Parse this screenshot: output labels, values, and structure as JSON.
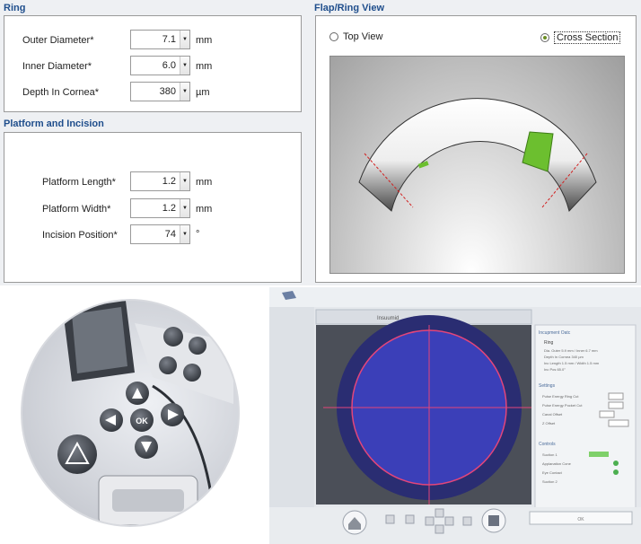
{
  "ring": {
    "title": "Ring",
    "fields": [
      {
        "label": "Outer Diameter*",
        "value": "7.1",
        "unit": "mm"
      },
      {
        "label": "Inner Diameter*",
        "value": "6.0",
        "unit": "mm"
      },
      {
        "label": "Depth In Cornea*",
        "value": "380",
        "unit": "µm"
      }
    ]
  },
  "platform": {
    "title": "Platform and Incision",
    "fields": [
      {
        "label": "Platform Length*",
        "value": "1.2",
        "unit": "mm"
      },
      {
        "label": "Platform Width*",
        "value": "1.2",
        "unit": "mm"
      },
      {
        "label": "Incision Position*",
        "value": "74",
        "unit": "°"
      }
    ]
  },
  "flap_view": {
    "title": "Flap/Ring View",
    "options": [
      {
        "label": "Top View",
        "selected": false
      },
      {
        "label": "Cross Section",
        "selected": true
      }
    ]
  },
  "spin_arrow": "▼",
  "photo_device": {
    "ok_label": "OK"
  },
  "photo_screen": {
    "tab_label": "Insuumid",
    "info_title": "Incupment Oatc",
    "ring_label": "Ring",
    "ring_lines": [
      "Dia. Outer 5.9 mm / Inner 6.7 mm",
      "Depth In Cornea 340 µm",
      "Inc Length 1.5 mm / Width 1.5 mm",
      "Inc Pos 65.0°"
    ],
    "settings_title": "Settings",
    "settings_lines": [
      "Pulse Energy Ring Cut",
      "Pulse Energy Pocket Cut",
      "Canal Offset",
      "Z Offset"
    ],
    "controls_title": "Controls",
    "controls_lines": [
      "Suction 1",
      "Applanation Cone",
      "Eye Contact",
      "Suction 2"
    ],
    "bottom_button": "OK"
  },
  "colors": {
    "title_blue": "#1f4e8c",
    "platform_green": "#6cbf2f",
    "incision_red": "#d21f1f",
    "screen_blue": "#3b3fb8"
  }
}
